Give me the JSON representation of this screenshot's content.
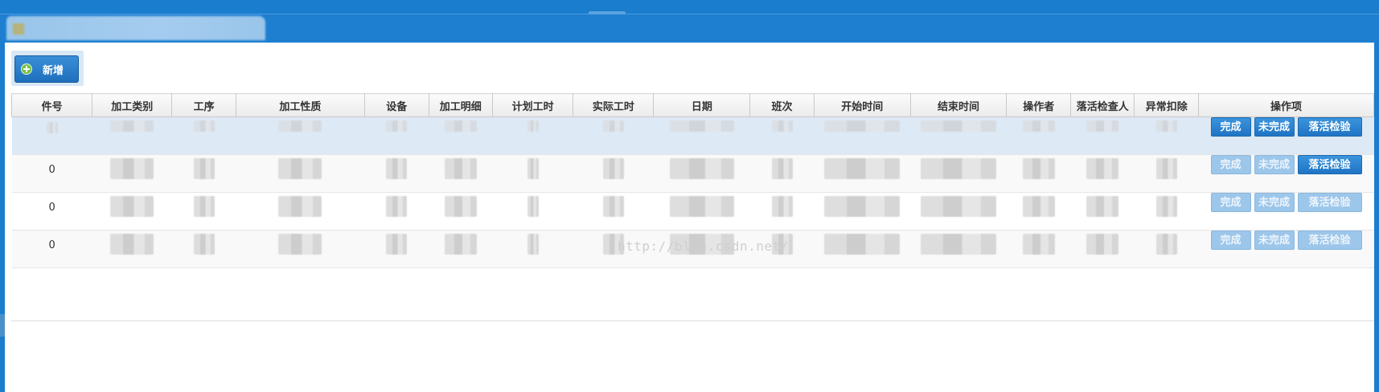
{
  "toolbar": {
    "add_label": "新增"
  },
  "table": {
    "headers": [
      "件号",
      "加工类别",
      "工序",
      "加工性质",
      "设备",
      "加工明细",
      "计划工时",
      "实际工时",
      "日期",
      "班次",
      "开始时间",
      "结束时间",
      "操作者",
      "落活检查人",
      "异常扣除",
      "操作项"
    ],
    "rows": [
      {
        "piece_no": "",
        "selected": true,
        "buttons": [
          {
            "label": "完成",
            "enabled": true
          },
          {
            "label": "未完成",
            "enabled": true
          },
          {
            "label": "落活检验",
            "enabled": true
          }
        ]
      },
      {
        "piece_no": "0",
        "selected": false,
        "buttons": [
          {
            "label": "完成",
            "enabled": false
          },
          {
            "label": "未完成",
            "enabled": false
          },
          {
            "label": "落活检验",
            "enabled": true
          }
        ]
      },
      {
        "piece_no": "0",
        "selected": false,
        "buttons": [
          {
            "label": "完成",
            "enabled": false
          },
          {
            "label": "未完成",
            "enabled": false
          },
          {
            "label": "落活检验",
            "enabled": false
          }
        ]
      },
      {
        "piece_no": "0",
        "selected": false,
        "buttons": [
          {
            "label": "完成",
            "enabled": false
          },
          {
            "label": "未完成",
            "enabled": false
          },
          {
            "label": "落活检验",
            "enabled": false
          }
        ]
      }
    ]
  },
  "watermark": "http://blog.csdn.net/",
  "colors": {
    "header_bar": "#1a7dcd",
    "button_primary": "#1f74c4",
    "button_disabled": "#9cc6ea",
    "selected_row": "#dde9f5"
  }
}
